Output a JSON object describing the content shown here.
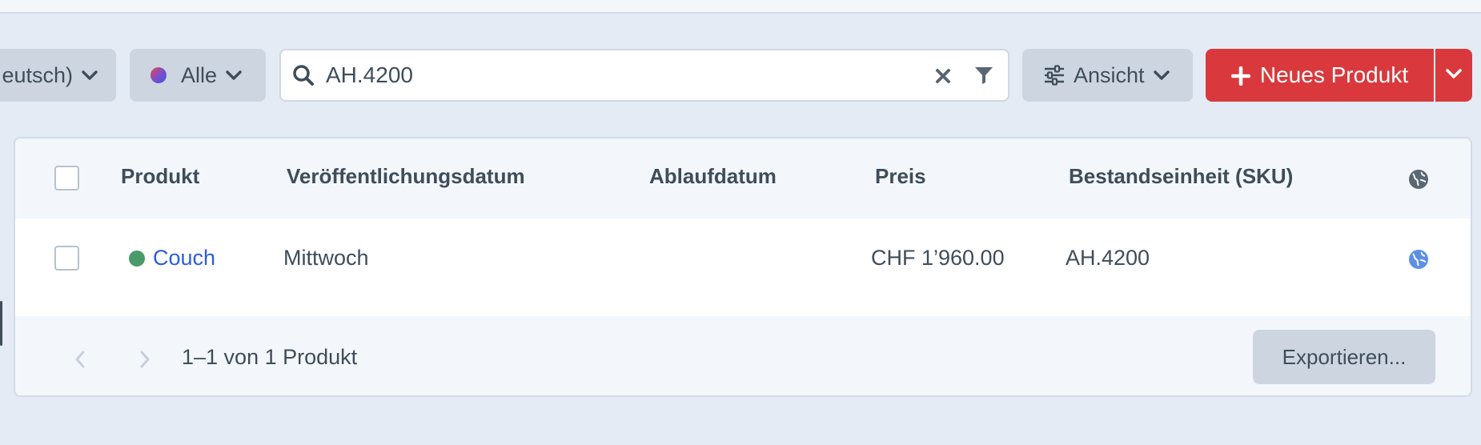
{
  "toolbar": {
    "site_label": "eutsch)",
    "status_label": "Alle",
    "search_value": "AH.4200",
    "view_label": "Ansicht",
    "new_product_label": "Neues Produkt"
  },
  "table": {
    "headers": {
      "product": "Produkt",
      "post_date": "Veröffentlichungsdatum",
      "expiry_date": "Ablaufdatum",
      "price": "Preis",
      "sku": "Bestandseinheit (SKU)"
    },
    "rows": [
      {
        "product": "Couch",
        "status_color": "#4a9a6a",
        "post_date": "Mittwoch",
        "expiry_date": "",
        "price": "CHF 1’960.00",
        "sku": "AH.4200"
      }
    ]
  },
  "footer": {
    "pagination_text": "1–1 von 1 Produkt",
    "export_label": "Exportieren..."
  },
  "colors": {
    "accent_red": "#d9393d",
    "link_blue": "#2b5fd9",
    "live_green": "#4a9a6a",
    "button_gray": "#cdd6e0"
  },
  "icons": [
    "chevron-down-icon",
    "status-gradient-icon",
    "search-icon",
    "clear-icon",
    "filter-icon",
    "sliders-icon",
    "plus-icon",
    "globe-icon",
    "chevron-left-icon",
    "chevron-right-icon"
  ]
}
